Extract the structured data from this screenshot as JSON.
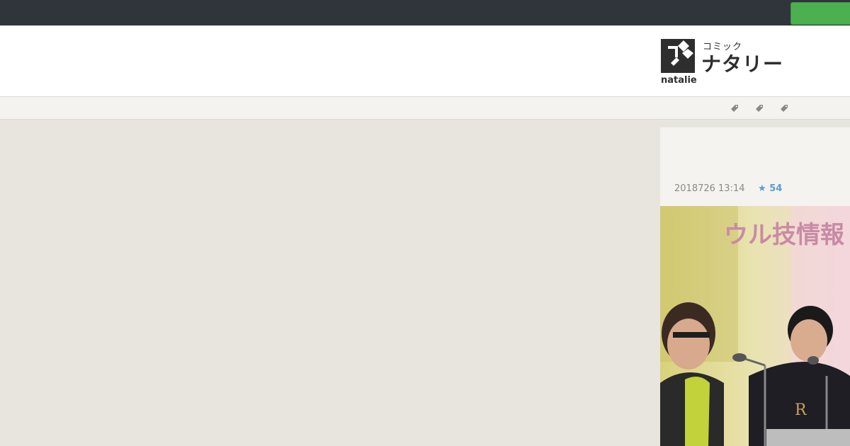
{
  "topbar": {
    "action_button_label": ""
  },
  "logo": {
    "small": "コミック",
    "big": "ナタリー",
    "brand": "natalie"
  },
  "subnav": {
    "tag_icons": [
      "tag-icon",
      "tag-icon",
      "tag-icon"
    ]
  },
  "article": {
    "date": "2018726 13:14",
    "star_count": "54",
    "star_symbol": "★",
    "photo_text": "ウル技情報"
  },
  "colors": {
    "topbar": "#30343b",
    "accent_green": "#4caf50",
    "page_bg": "#e8e4de",
    "star_blue": "#5a9bd5"
  }
}
